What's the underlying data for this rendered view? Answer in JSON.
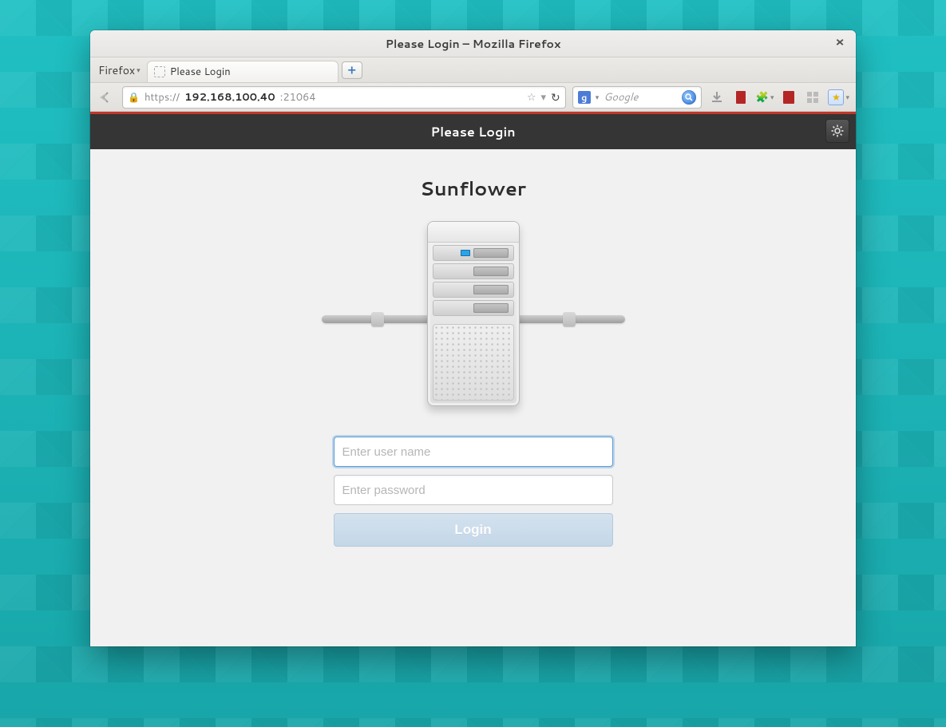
{
  "window": {
    "title": "Please Login – Mozilla Firefox"
  },
  "tabstrip": {
    "menu_label": "Firefox",
    "tab_label": "Please Login",
    "newtab_glyph": "+"
  },
  "url": {
    "protocol": "https://",
    "host": "192.168.100.40",
    "port": ":21064"
  },
  "searchbox": {
    "engine_letter": "g",
    "placeholder": "Google"
  },
  "page": {
    "header_title": "Please Login",
    "hostname": "Sunflower"
  },
  "login": {
    "username_value": "",
    "username_placeholder": "Enter user name",
    "password_value": "",
    "password_placeholder": "Enter password",
    "button_label": "Login"
  }
}
